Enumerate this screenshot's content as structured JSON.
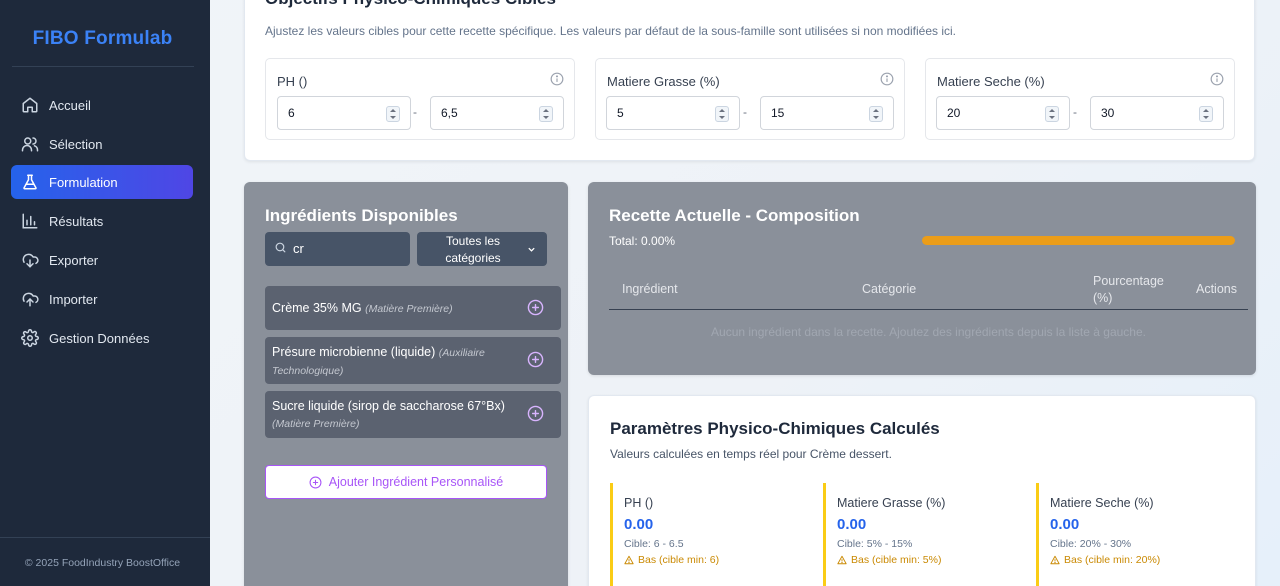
{
  "sidebar": {
    "brand": "FIBO Formulab",
    "items": [
      {
        "label": "Accueil",
        "icon": "home-icon"
      },
      {
        "label": "Sélection",
        "icon": "users-icon"
      },
      {
        "label": "Formulation",
        "icon": "flask-icon",
        "active": true
      },
      {
        "label": "Résultats",
        "icon": "bar-chart-icon"
      },
      {
        "label": "Exporter",
        "icon": "cloud-download-icon"
      },
      {
        "label": "Importer",
        "icon": "cloud-upload-icon"
      },
      {
        "label": "Gestion Données",
        "icon": "gear-icon"
      }
    ],
    "footer": "© 2025 FoodIndustry BoostOffice"
  },
  "objectives": {
    "title": "Objectifs Physico-Chimiques Cibles",
    "subtitle": "Ajustez les valeurs cibles pour cette recette spécifique. Les valeurs par défaut de la sous-famille sont utilisées si non modifiées ici.",
    "params": [
      {
        "label": "PH ()",
        "min": "6",
        "max": "6,5",
        "separator": "-"
      },
      {
        "label": "Matiere Grasse (%)",
        "min": "5",
        "max": "15",
        "separator": "-"
      },
      {
        "label": "Matiere Seche (%)",
        "min": "20",
        "max": "30",
        "separator": "-"
      }
    ]
  },
  "ingredients": {
    "title": "Ingrédients Disponibles",
    "search_value": "cr",
    "category_filter": "Toutes les catégories",
    "items": [
      {
        "name": "Crème 35% MG",
        "category": "(Matière Première)"
      },
      {
        "name": "Présure microbienne (liquide)",
        "category": "(Auxiliaire Technologique)"
      },
      {
        "name": "Sucre liquide (sirop de saccharose 67°Bx)",
        "category": "(Matière Première)"
      }
    ],
    "add_custom_label": "Ajouter Ingrédient Personnalisé"
  },
  "recipe": {
    "title": "Recette Actuelle - Composition",
    "total": "Total: 0.00%",
    "columns": [
      "Ingrédient",
      "Catégorie",
      "Pourcentage (%)",
      "Actions"
    ],
    "empty_message": "Aucun ingrédient dans la recette. Ajoutez des ingrédients depuis la liste à gauche.",
    "bar_color": "#f59e0b"
  },
  "calculated": {
    "title": "Paramètres Physico-Chimiques Calculés",
    "subtitle": "Valeurs calculées en temps réel pour Crème dessert.",
    "metrics": [
      {
        "label": "PH ()",
        "value": "0.00",
        "target": "Cible: 6 - 6.5",
        "warning": "Bas (cible min: 6)"
      },
      {
        "label": "Matiere Grasse (%)",
        "value": "0.00",
        "target": "Cible: 5% - 15%",
        "warning": "Bas (cible min: 5%)"
      },
      {
        "label": "Matiere Seche (%)",
        "value": "0.00",
        "target": "Cible: 20% - 30%",
        "warning": "Bas (cible min: 20%)"
      }
    ],
    "accent_color": "#facc15"
  }
}
